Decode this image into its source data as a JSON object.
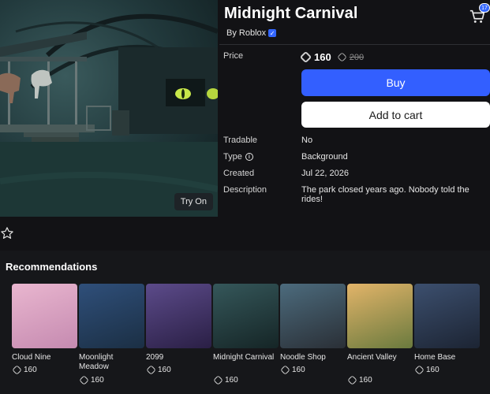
{
  "item": {
    "title": "Midnight Carnival",
    "creator": "By Roblox",
    "try_on": "Try On"
  },
  "cart": {
    "count": "17"
  },
  "details": {
    "price_label": "Price",
    "price": "160",
    "price_old": "200",
    "buy_label": "Buy",
    "add_to_cart_label": "Add to cart",
    "tradable_label": "Tradable",
    "tradable_value": "No",
    "type_label": "Type",
    "type_value": "Background",
    "created_label": "Created",
    "created_value": "Jul 22, 2026",
    "description_label": "Description",
    "description_value": "The park closed years ago. Nobody told the rides!"
  },
  "recommendations": {
    "title": "Recommendations",
    "items": [
      {
        "name": "Cloud Nine",
        "price": "160",
        "colors": [
          "#e9b6cf",
          "#c58ab0"
        ]
      },
      {
        "name": "Moonlight Meadow",
        "price": "160",
        "colors": [
          "#2f4f7a",
          "#1b2f44"
        ]
      },
      {
        "name": "2099",
        "price": "160",
        "colors": [
          "#5c4b8a",
          "#2a1f45"
        ]
      },
      {
        "name": "Midnight Carnival",
        "price": "160",
        "colors": [
          "#35575a",
          "#152526"
        ]
      },
      {
        "name": "Noodle Shop",
        "price": "160",
        "colors": [
          "#4c6b7d",
          "#2a2f36"
        ]
      },
      {
        "name": "Ancient Valley",
        "price": "160",
        "colors": [
          "#e2b469",
          "#6a7a3e"
        ]
      },
      {
        "name": "Home Base",
        "price": "160",
        "colors": [
          "#3c4f6e",
          "#1c2433"
        ]
      }
    ]
  },
  "theme": {
    "accent": "#335fff",
    "background": "#121215"
  }
}
